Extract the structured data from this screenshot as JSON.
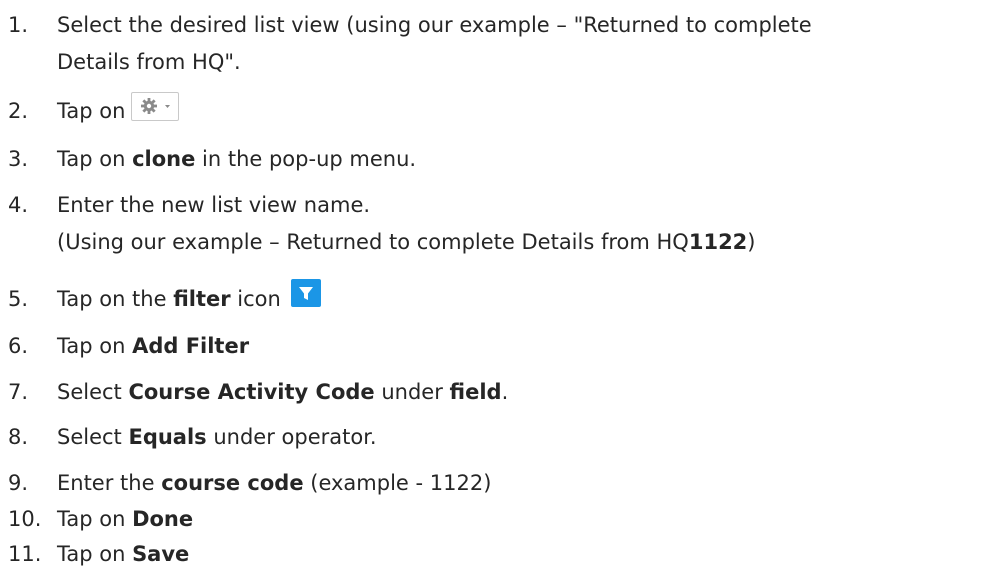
{
  "steps": [
    {
      "number": "1.",
      "line1": "Select the desired list view (using our example – \"Returned to complete",
      "line2": "Details from HQ\"."
    },
    {
      "number": "2.",
      "text": "Tap on",
      "icon": "gear-dropdown-icon"
    },
    {
      "number": "3.",
      "pre": "Tap on ",
      "bold": "clone",
      "post": " in the pop-up menu."
    },
    {
      "number": "4.",
      "line1": "Enter the new list view name.",
      "line2_pre": "(Using our example – Returned to complete Details from HQ",
      "line2_bold": "1122",
      "line2_post": ")"
    },
    {
      "number": "5.",
      "pre": "Tap on the ",
      "bold": "filter",
      "post": " icon",
      "icon": "filter-icon"
    },
    {
      "number": "6.",
      "pre": "Tap on ",
      "bold": "Add Filter"
    },
    {
      "number": "7.",
      "pre": "Select ",
      "bold": "Course Activity Code",
      "mid": " under ",
      "bold2": "field",
      "post": "."
    },
    {
      "number": "8.",
      "pre": "Select ",
      "bold": "Equals",
      "post": " under operator."
    },
    {
      "number": "9.",
      "pre": "Enter the ",
      "bold": "course code",
      "post": " (example - 1122)"
    },
    {
      "number": "10.",
      "pre": "Tap on ",
      "bold": "Done"
    },
    {
      "number": "11.",
      "pre": "Tap on ",
      "bold": "Save"
    }
  ],
  "colors": {
    "text": "#262626",
    "filter_button_bg": "#1b96e6",
    "gear_border": "#c9c9c9",
    "gear_icon": "#8a8a8a"
  }
}
